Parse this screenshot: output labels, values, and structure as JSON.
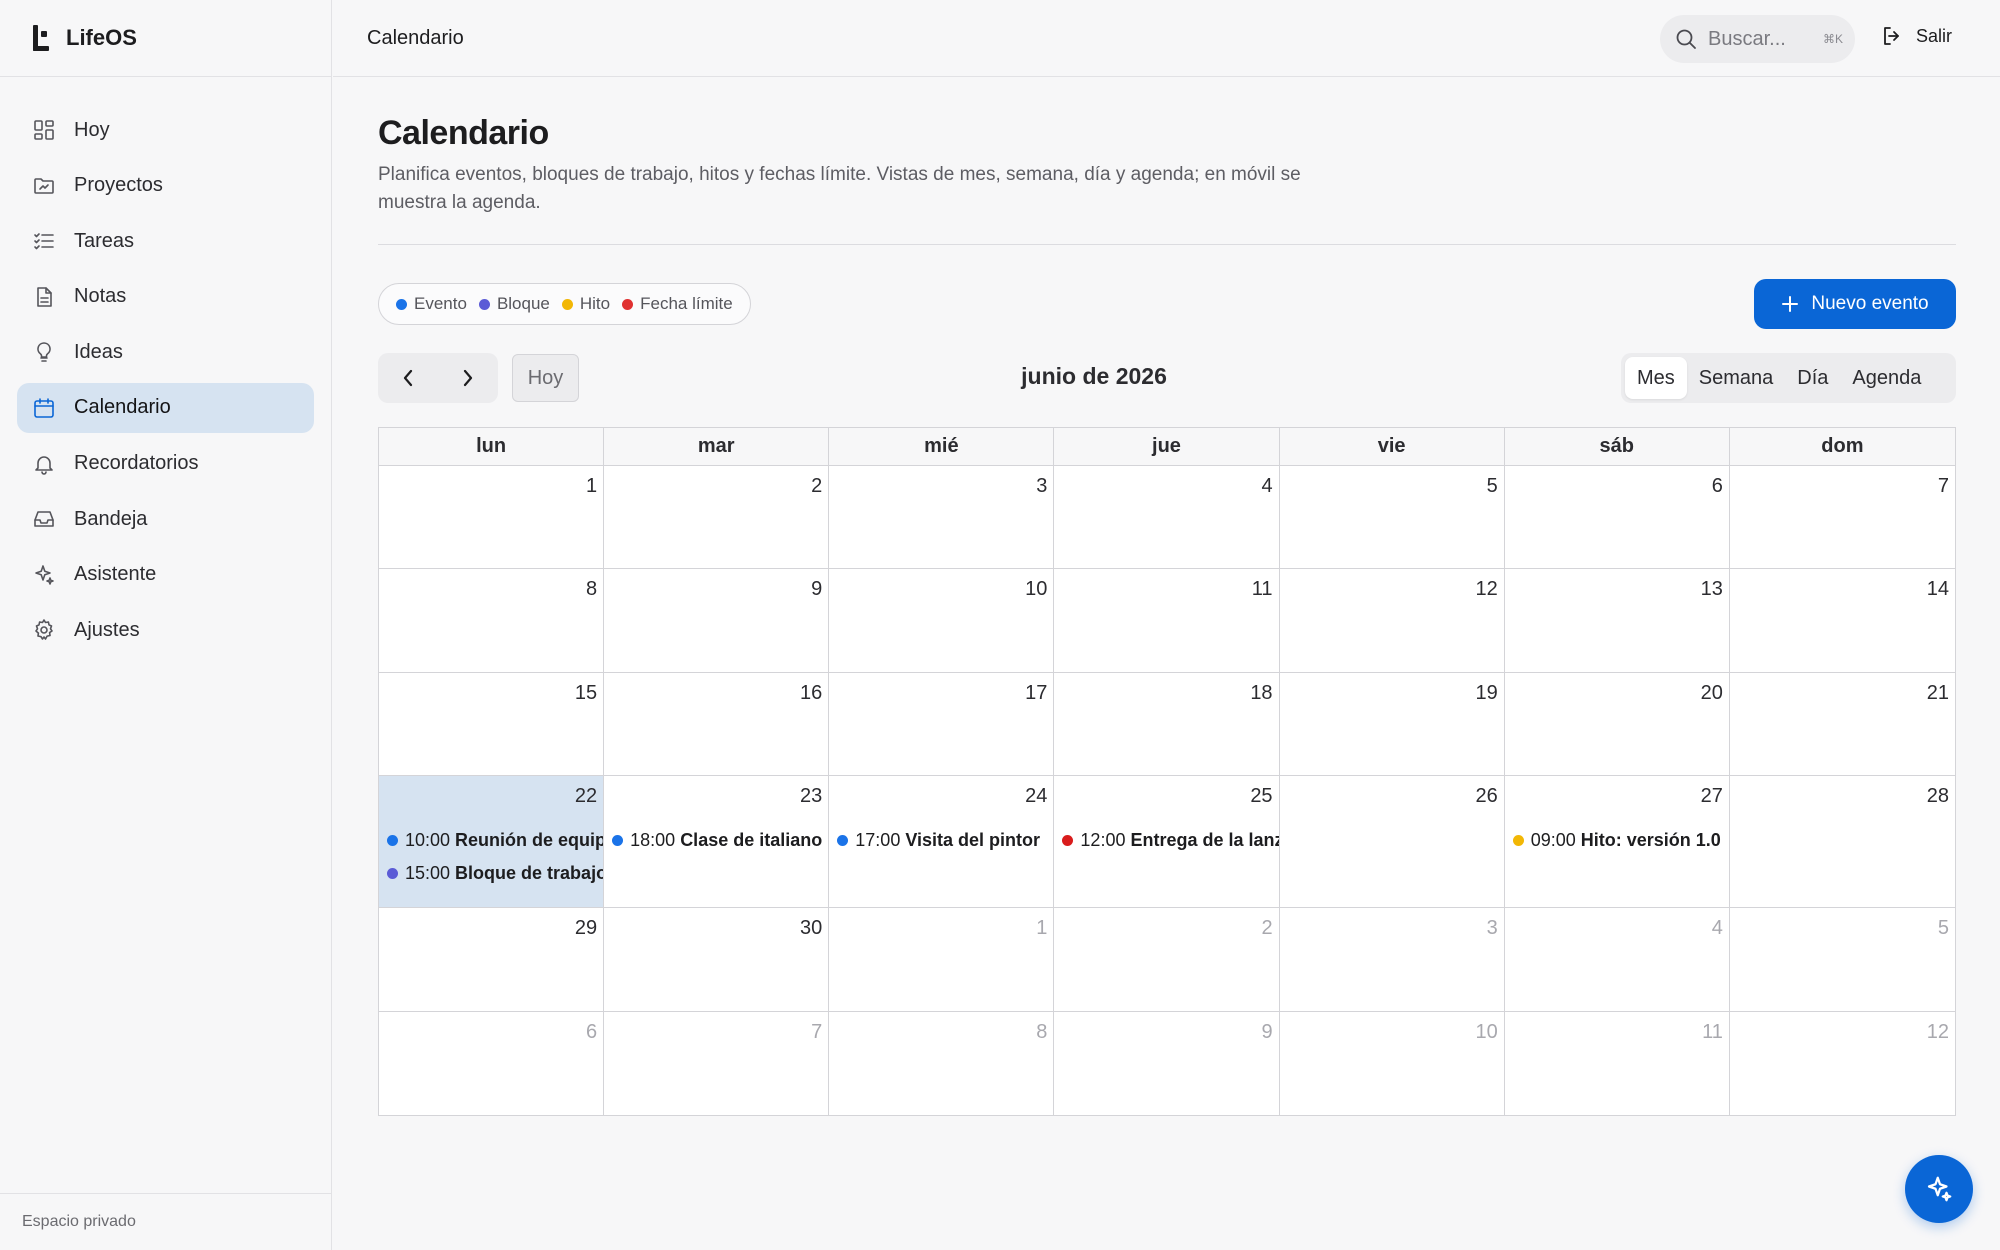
{
  "app": {
    "name": "LifeOS"
  },
  "sidebar": {
    "items": [
      {
        "label": "Hoy",
        "icon": "dashboard-icon"
      },
      {
        "label": "Proyectos",
        "icon": "folder-icon"
      },
      {
        "label": "Tareas",
        "icon": "checklist-icon"
      },
      {
        "label": "Notas",
        "icon": "document-icon"
      },
      {
        "label": "Ideas",
        "icon": "lightbulb-icon"
      },
      {
        "label": "Calendario",
        "icon": "calendar-icon",
        "active": true
      },
      {
        "label": "Recordatorios",
        "icon": "bell-icon"
      },
      {
        "label": "Bandeja",
        "icon": "inbox-icon"
      },
      {
        "label": "Asistente",
        "icon": "sparkles-icon"
      },
      {
        "label": "Ajustes",
        "icon": "gear-icon"
      }
    ],
    "footer": "Espacio privado"
  },
  "topbar": {
    "title": "Calendario",
    "search_placeholder": "Buscar...",
    "search_shortcut": "⌘K",
    "logout_label": "Salir"
  },
  "page": {
    "title": "Calendario",
    "description": "Planifica eventos, bloques de trabajo, hitos y fechas límite. Vistas de mes, semana, día y agenda; en móvil se muestra la agenda."
  },
  "legend": [
    {
      "label": "Evento",
      "color": "#1a73e8"
    },
    {
      "label": "Bloque",
      "color": "#5b5bd6"
    },
    {
      "label": "Hito",
      "color": "#f2b705"
    },
    {
      "label": "Fecha límite",
      "color": "#e03131"
    }
  ],
  "new_event_label": "Nuevo evento",
  "toolbar": {
    "today_label": "Hoy",
    "month_title": "junio de 2026"
  },
  "views": [
    {
      "label": "Mes",
      "active": true
    },
    {
      "label": "Semana"
    },
    {
      "label": "Día"
    },
    {
      "label": "Agenda"
    }
  ],
  "calendar": {
    "weekdays": [
      "lun",
      "mar",
      "mié",
      "jue",
      "vie",
      "sáb",
      "dom"
    ],
    "weeks": [
      [
        {
          "day": "1"
        },
        {
          "day": "2"
        },
        {
          "day": "3"
        },
        {
          "day": "4"
        },
        {
          "day": "5"
        },
        {
          "day": "6"
        },
        {
          "day": "7"
        }
      ],
      [
        {
          "day": "8"
        },
        {
          "day": "9"
        },
        {
          "day": "10"
        },
        {
          "day": "11"
        },
        {
          "day": "12"
        },
        {
          "day": "13"
        },
        {
          "day": "14"
        }
      ],
      [
        {
          "day": "15"
        },
        {
          "day": "16"
        },
        {
          "day": "17"
        },
        {
          "day": "18"
        },
        {
          "day": "19"
        },
        {
          "day": "20"
        },
        {
          "day": "21"
        }
      ],
      [
        {
          "day": "22",
          "today": true,
          "events": [
            {
              "time": "10:00",
              "title": "Reunión de equipo",
              "kind": "Evento",
              "color": "#1a73e8"
            },
            {
              "time": "15:00",
              "title": "Bloque de trabajo",
              "kind": "Bloque",
              "color": "#5b5bd6"
            }
          ]
        },
        {
          "day": "23",
          "events": [
            {
              "time": "18:00",
              "title": "Clase de italiano",
              "kind": "Evento",
              "color": "#1a73e8"
            }
          ]
        },
        {
          "day": "24",
          "events": [
            {
              "time": "17:00",
              "title": "Visita del pintor",
              "kind": "Evento",
              "color": "#1a73e8"
            }
          ]
        },
        {
          "day": "25",
          "events": [
            {
              "time": "12:00",
              "title": "Entrega de la lanzadera",
              "kind": "Fecha límite",
              "color": "#d91c1c"
            }
          ]
        },
        {
          "day": "26"
        },
        {
          "day": "27",
          "events": [
            {
              "time": "09:00",
              "title": "Hito: versión 1.0",
              "kind": "Hito",
              "color": "#f2b705"
            }
          ]
        },
        {
          "day": "28"
        }
      ],
      [
        {
          "day": "29"
        },
        {
          "day": "30"
        },
        {
          "day": "1",
          "muted": true
        },
        {
          "day": "2",
          "muted": true
        },
        {
          "day": "3",
          "muted": true
        },
        {
          "day": "4",
          "muted": true
        },
        {
          "day": "5",
          "muted": true
        }
      ],
      [
        {
          "day": "6",
          "muted": true
        },
        {
          "day": "7",
          "muted": true
        },
        {
          "day": "8",
          "muted": true
        },
        {
          "day": "9",
          "muted": true
        },
        {
          "day": "10",
          "muted": true
        },
        {
          "day": "11",
          "muted": true
        },
        {
          "day": "12",
          "muted": true
        }
      ]
    ]
  },
  "fab": {
    "icon": "sparkles-icon"
  }
}
